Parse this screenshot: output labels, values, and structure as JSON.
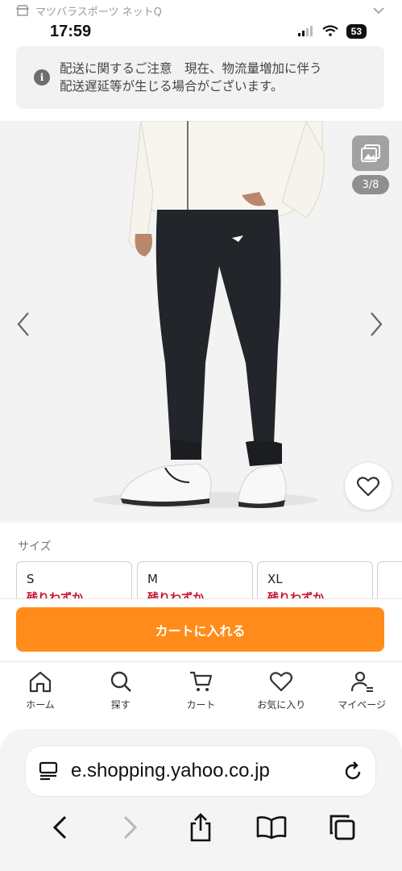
{
  "store_bar": {
    "name": "マツバラスポーツ ネットQ",
    "icon": "store-icon",
    "chevron": "chevron-down-icon"
  },
  "status_bar": {
    "time": "17:59",
    "battery": "53"
  },
  "notice": {
    "icon": "info-icon",
    "text_line1": "配送に関するご注意　現在、物流量増加に伴う",
    "text_line2": "配送遅延等が生じる場合がございます。"
  },
  "gallery": {
    "counter": "3/8",
    "prev_icon": "chevron-left-icon",
    "next_icon": "chevron-right-icon",
    "gallery_icon": "image-gallery-icon",
    "favorite_icon": "heart-icon"
  },
  "sizes": {
    "label": "サイズ",
    "options": [
      {
        "name": "S",
        "stock": "残りわずか"
      },
      {
        "name": "M",
        "stock": "残りわずか"
      },
      {
        "name": "XL",
        "stock": "残りわずか"
      }
    ]
  },
  "cart_button": {
    "label": "カートに入れる"
  },
  "app_nav": {
    "items": [
      {
        "label": "ホーム",
        "icon": "home-icon"
      },
      {
        "label": "探す",
        "icon": "search-icon"
      },
      {
        "label": "カート",
        "icon": "cart-icon"
      },
      {
        "label": "お気に入り",
        "icon": "heart-icon"
      },
      {
        "label": "マイページ",
        "icon": "user-icon"
      }
    ]
  },
  "browser": {
    "url": "e.shopping.yahoo.co.jp",
    "icons": [
      "reader-icon",
      "reload-icon",
      "back-icon",
      "forward-icon",
      "share-icon",
      "bookmarks-icon",
      "tabs-icon"
    ]
  },
  "colors": {
    "accent": "#ff8c1a",
    "stock_red": "#c8102e"
  }
}
